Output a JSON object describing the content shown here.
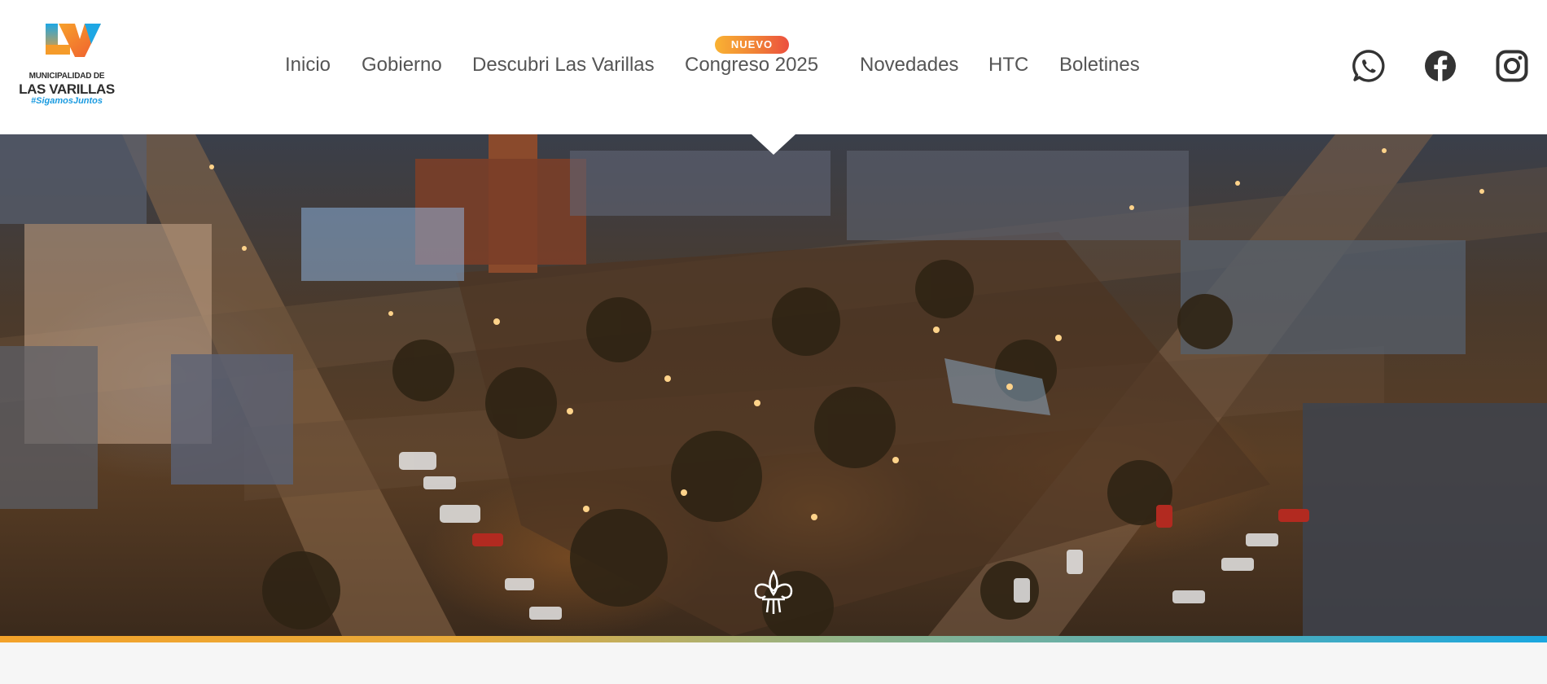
{
  "logo": {
    "line1": "MUNICIPALIDAD DE",
    "line2": "LAS VARILLAS",
    "tagline": "#SigamosJuntos",
    "icon": "lv-logo-icon"
  },
  "nav": {
    "items": [
      {
        "label": "Inicio"
      },
      {
        "label": "Gobierno"
      },
      {
        "label": "Descubri Las Varillas"
      },
      {
        "label": "Congreso 2025"
      },
      {
        "label": "Novedades"
      },
      {
        "label": "HTC"
      },
      {
        "label": "Boletines"
      }
    ],
    "badge": "NUEVO"
  },
  "social": {
    "items": [
      {
        "icon": "whatsapp-icon"
      },
      {
        "icon": "facebook-icon"
      },
      {
        "icon": "instagram-icon"
      }
    ]
  },
  "hero": {
    "image": "aerial-night-town-square",
    "emblem_icon": "fleur-emblem-icon"
  },
  "colors": {
    "header_bg": "#ffffff",
    "nav_text": "#555555",
    "badge_start": "#f9b233",
    "badge_end": "#ec4f3f",
    "bar_start": "#f3a22a",
    "bar_end": "#1aa7e0",
    "icon_color": "#333333"
  }
}
